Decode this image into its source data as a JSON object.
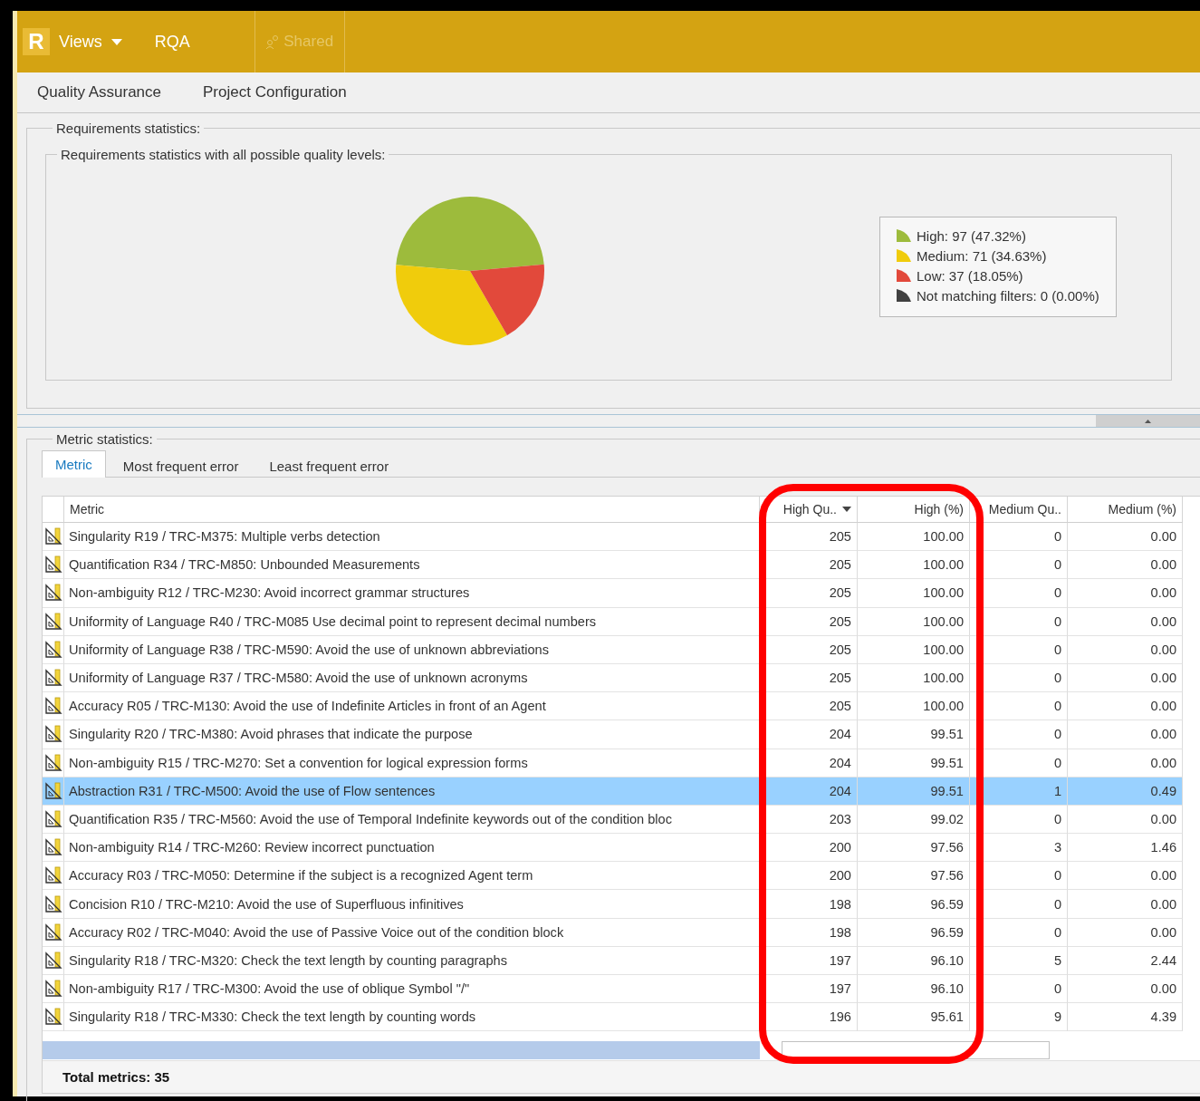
{
  "top_bar": {
    "logo": "R",
    "menu": {
      "label": "Views"
    },
    "view": "RQA",
    "shared_button": {
      "label": "Shared",
      "disabled": true
    }
  },
  "ribbon_tabs": [
    {
      "label": "Quality Assurance"
    },
    {
      "label": "Project Configuration"
    }
  ],
  "requirements_statistics": {
    "title": "Requirements statistics:",
    "chart_group_title": "Requirements statistics with all possible quality levels:",
    "chart_data": {
      "type": "pie",
      "values": [
        47.32,
        34.63,
        18.05,
        0
      ]
    },
    "legend": [
      {
        "label": "High: 97  (47.32%)",
        "color": "#9dbb3c"
      },
      {
        "label": "Medium: 71  (34.63%)",
        "color": "#f0cc0c"
      },
      {
        "label": "Low: 37  (18.05%)",
        "color": "#e2493b"
      },
      {
        "label": "Not matching filters: 0  (0.00%)",
        "color": "#404040"
      }
    ]
  },
  "metric_statistics": {
    "title": "Metric statistics:",
    "tabs": [
      {
        "label": "Metric",
        "selected": true
      },
      {
        "label": "Most frequent error",
        "selected": false
      },
      {
        "label": "Least frequent error",
        "selected": false
      }
    ],
    "table": {
      "columns": [
        {
          "label": "Metric",
          "sorted": false
        },
        {
          "label": "High Qu..",
          "sorted": true
        },
        {
          "label": "High (%)",
          "sorted": false
        },
        {
          "label": "Medium Qu..",
          "sorted": false
        },
        {
          "label": "Medium (%)",
          "sorted": false
        }
      ],
      "rows": [
        {
          "cells": [
            "Singularity R19 / TRC-M375: Multiple verbs detection",
            "205",
            "100.00",
            "0",
            "0.00"
          ],
          "selected": false
        },
        {
          "cells": [
            "Quantification R34 / TRC-M850: Unbounded Measurements",
            "205",
            "100.00",
            "0",
            "0.00"
          ],
          "selected": false
        },
        {
          "cells": [
            "Non-ambiguity R12 / TRC-M230: Avoid incorrect grammar structures",
            "205",
            "100.00",
            "0",
            "0.00"
          ],
          "selected": false
        },
        {
          "cells": [
            "Uniformity of Language R40 / TRC-M085 Use decimal point to represent decimal numbers",
            "205",
            "100.00",
            "0",
            "0.00"
          ],
          "selected": false
        },
        {
          "cells": [
            "Uniformity of Language R38 / TRC-M590: Avoid the use of unknown abbreviations",
            "205",
            "100.00",
            "0",
            "0.00"
          ],
          "selected": false
        },
        {
          "cells": [
            "Uniformity of Language R37 / TRC-M580: Avoid the use of unknown acronyms",
            "205",
            "100.00",
            "0",
            "0.00"
          ],
          "selected": false
        },
        {
          "cells": [
            "Accuracy R05 / TRC-M130: Avoid the use of Indefinite Articles in front of an Agent",
            "205",
            "100.00",
            "0",
            "0.00"
          ],
          "selected": false
        },
        {
          "cells": [
            "Singularity R20 / TRC-M380: Avoid phrases that indicate the purpose",
            "204",
            "99.51",
            "0",
            "0.00"
          ],
          "selected": false
        },
        {
          "cells": [
            "Non-ambiguity R15 / TRC-M270: Set a convention for logical expression forms",
            "204",
            "99.51",
            "0",
            "0.00"
          ],
          "selected": false
        },
        {
          "cells": [
            "Abstraction R31 / TRC-M500: Avoid the use of Flow sentences",
            "204",
            "99.51",
            "1",
            "0.49"
          ],
          "selected": true
        },
        {
          "cells": [
            "Quantification R35 / TRC-M560: Avoid the use of Temporal Indefinite keywords out of the condition bloc",
            "203",
            "99.02",
            "0",
            "0.00"
          ],
          "selected": false
        },
        {
          "cells": [
            "Non-ambiguity R14 / TRC-M260: Review incorrect punctuation",
            "200",
            "97.56",
            "3",
            "1.46"
          ],
          "selected": false
        },
        {
          "cells": [
            "Accuracy R03 / TRC-M050: Determine if the subject is a recognized Agent term",
            "200",
            "97.56",
            "0",
            "0.00"
          ],
          "selected": false
        },
        {
          "cells": [
            "Concision R10 / TRC-M210: Avoid the use of Superfluous infinitives",
            "198",
            "96.59",
            "0",
            "0.00"
          ],
          "selected": false
        },
        {
          "cells": [
            "Accuracy R02 / TRC-M040: Avoid the use of Passive Voice out of the condition block",
            "198",
            "96.59",
            "0",
            "0.00"
          ],
          "selected": false
        },
        {
          "cells": [
            "Singularity R18 / TRC-M320: Check the text length by counting paragraphs",
            "197",
            "96.10",
            "5",
            "2.44"
          ],
          "selected": false
        },
        {
          "cells": [
            "Non-ambiguity R17 / TRC-M300: Avoid the use of oblique Symbol \"/\"",
            "197",
            "96.10",
            "0",
            "0.00"
          ],
          "selected": false
        },
        {
          "cells": [
            "Singularity R18 / TRC-M330: Check the text length by counting words",
            "196",
            "95.61",
            "9",
            "4.39"
          ],
          "selected": false
        }
      ]
    },
    "footer": "Total metrics: 35"
  }
}
